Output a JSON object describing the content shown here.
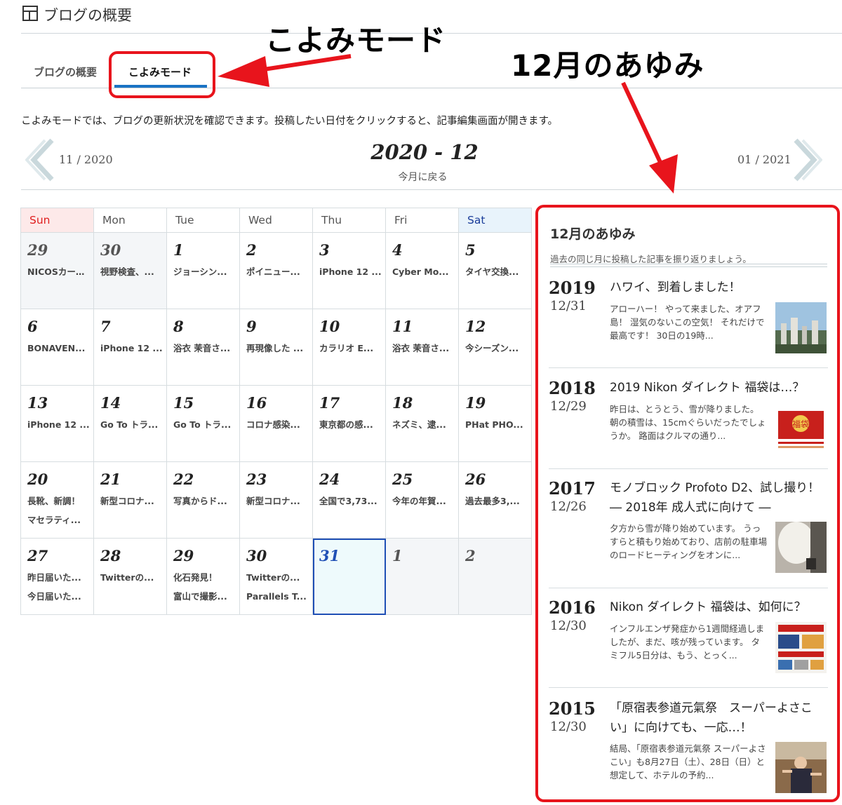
{
  "header": {
    "title": "ブログの概要"
  },
  "annotations": {
    "koyomi": "こよみモード",
    "ayumi": "12月のあゆみ"
  },
  "tabs": [
    {
      "label": "ブログの概要"
    },
    {
      "label": "こよみモード"
    }
  ],
  "description": "こよみモードでは、ブログの更新状況を確認できます。投稿したい日付をクリックすると、記事編集画面が開きます。",
  "month_nav": {
    "prev": "11 / 2020",
    "current": "2020 - 12",
    "back": "今月に戻る",
    "next": "01 / 2021"
  },
  "calendar": {
    "weekdays": [
      "Sun",
      "Mon",
      "Tue",
      "Wed",
      "Thu",
      "Fri",
      "Sat"
    ],
    "weeks": [
      [
        {
          "day": "29",
          "other": true,
          "entries": [
            "NICOSカード..."
          ]
        },
        {
          "day": "30",
          "other": true,
          "entries": [
            "視野検査、..."
          ]
        },
        {
          "day": "1",
          "entries": [
            "ジョーシン..."
          ]
        },
        {
          "day": "2",
          "entries": [
            "ポイニュー..."
          ]
        },
        {
          "day": "3",
          "entries": [
            "iPhone 12 ..."
          ]
        },
        {
          "day": "4",
          "entries": [
            "Cyber Mo..."
          ]
        },
        {
          "day": "5",
          "entries": [
            "タイヤ交換..."
          ]
        }
      ],
      [
        {
          "day": "6",
          "entries": [
            "BONAVEN..."
          ]
        },
        {
          "day": "7",
          "entries": [
            "iPhone 12 ..."
          ]
        },
        {
          "day": "8",
          "entries": [
            "浴衣 茉音さ..."
          ]
        },
        {
          "day": "9",
          "entries": [
            "再現像した ..."
          ]
        },
        {
          "day": "10",
          "entries": [
            "カラリオ E..."
          ]
        },
        {
          "day": "11",
          "entries": [
            "浴衣 茉音さ..."
          ]
        },
        {
          "day": "12",
          "entries": [
            "今シーズン..."
          ]
        }
      ],
      [
        {
          "day": "13",
          "entries": [
            "iPhone 12 ..."
          ]
        },
        {
          "day": "14",
          "entries": [
            "Go To トラ..."
          ]
        },
        {
          "day": "15",
          "entries": [
            "Go To トラ..."
          ]
        },
        {
          "day": "16",
          "entries": [
            "コロナ感染..."
          ]
        },
        {
          "day": "17",
          "entries": [
            "東京都の感..."
          ]
        },
        {
          "day": "18",
          "entries": [
            "ネズミ、逮..."
          ]
        },
        {
          "day": "19",
          "entries": [
            "PHat PHO..."
          ]
        }
      ],
      [
        {
          "day": "20",
          "entries": [
            "長靴、新調！",
            "マセラティ..."
          ]
        },
        {
          "day": "21",
          "entries": [
            "新型コロナ..."
          ]
        },
        {
          "day": "22",
          "entries": [
            "写真からド..."
          ]
        },
        {
          "day": "23",
          "entries": [
            "新型コロナ..."
          ]
        },
        {
          "day": "24",
          "entries": [
            "全国で3,73..."
          ]
        },
        {
          "day": "25",
          "entries": [
            "今年の年賀..."
          ]
        },
        {
          "day": "26",
          "entries": [
            "過去最多3,..."
          ]
        }
      ],
      [
        {
          "day": "27",
          "entries": [
            "昨日届いた...",
            "今日届いた..."
          ]
        },
        {
          "day": "28",
          "entries": [
            "Twitterの..."
          ]
        },
        {
          "day": "29",
          "entries": [
            "化石発見！",
            "富山で撮影..."
          ]
        },
        {
          "day": "30",
          "entries": [
            "Twitterの...",
            "Parallels T..."
          ]
        },
        {
          "day": "31",
          "today": true,
          "entries": []
        },
        {
          "day": "1",
          "other": true,
          "entries": []
        },
        {
          "day": "2",
          "other": true,
          "entries": []
        }
      ]
    ]
  },
  "sidebar": {
    "title": "12月のあゆみ",
    "subtitle": "過去の同じ月に投稿した記事を振り返りましょう。",
    "items": [
      {
        "year": "2019",
        "date": "12/31",
        "title": "ハワイ、到着しました！",
        "excerpt": "アローハー！ やって来ました、オアフ島！ 湿気のないこの空気！ それだけで最高です！ 30日の19時...",
        "thumb": "hawaii-city-photo"
      },
      {
        "year": "2018",
        "date": "12/29",
        "title": "2019 Nikon ダイレクト 福袋は…？",
        "excerpt": "昨日は、とうとう、雪が降りました。 朝の積雪は、15cmぐらいだったでしょうか。 路面はクルマの通り...",
        "thumb": "fukubukuro-ad"
      },
      {
        "year": "2017",
        "date": "12/26",
        "title": "モノブロック Profoto D2、試し撮り！ ― 2018年 成人式に向けて ―",
        "excerpt": "夕方から雪が降り始めています。 うっすらと積もり始めており、店前の駐車場のロードヒーティングをオンに...",
        "thumb": "studio-light-photo"
      },
      {
        "year": "2016",
        "date": "12/30",
        "title": "Nikon ダイレクト 福袋は、如何に？",
        "excerpt": "インフルエンザ発症から1週間経過しましたが、まだ、咳が残っています。 タミフル5日分は、もう、とっく...",
        "thumb": "nikon-fukubukuro-ad"
      },
      {
        "year": "2015",
        "date": "12/30",
        "title": "「原宿表参道元氣祭　スーパーよさこい」に向けても、一応…！",
        "excerpt": "結局、「原宿表参道元氣祭 スーパーよさこい」も8月27日（土）、28日（日）と想定して、ホテルの予約...",
        "thumb": "yosakoi-photo"
      }
    ]
  },
  "colors": {
    "accent_blue": "#1a73c4",
    "annotation_red": "#e8141c",
    "today_border": "#1f4fb5"
  }
}
